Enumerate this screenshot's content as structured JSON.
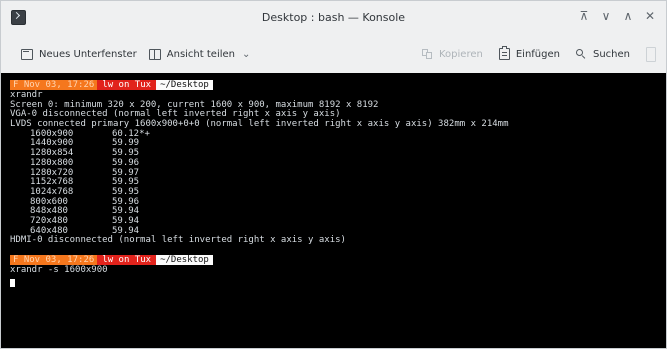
{
  "window": {
    "title": "Desktop : bash — Konsole",
    "controls": [
      {
        "name": "keep-above-button",
        "glyph": "⊼"
      },
      {
        "name": "minimize-button",
        "glyph": "∨"
      },
      {
        "name": "maximize-button",
        "glyph": "∧"
      },
      {
        "name": "close-button",
        "glyph": "✕"
      }
    ]
  },
  "toolbar": {
    "new_tab_label": "Neues Unterfenster",
    "split_view_label": "Ansicht teilen",
    "copy_label": "Kopieren",
    "paste_label": "Einfügen",
    "find_label": "Suchen"
  },
  "terminal": {
    "prompt1": {
      "time": "F Nov 03, 17:26",
      "user": "lw on Tux",
      "dir": "~/Desktop"
    },
    "command1": "xrandr",
    "lines": [
      "Screen 0: minimum 320 x 200, current 1600 x 900, maximum 8192 x 8192",
      "VGA-0 disconnected (normal left inverted right x axis y axis)",
      "LVDS connected primary 1600x900+0+0 (normal left inverted right x axis y axis) 382mm x 214mm"
    ],
    "modes": [
      {
        "name": "1600x900",
        "rate": "60.12*+"
      },
      {
        "name": "1440x900",
        "rate": "59.99"
      },
      {
        "name": "1280x854",
        "rate": "59.95"
      },
      {
        "name": "1280x800",
        "rate": "59.96"
      },
      {
        "name": "1280x720",
        "rate": "59.97"
      },
      {
        "name": "1152x768",
        "rate": "59.95"
      },
      {
        "name": "1024x768",
        "rate": "59.95"
      },
      {
        "name": "800x600",
        "rate": "59.96"
      },
      {
        "name": "848x480",
        "rate": "59.94"
      },
      {
        "name": "720x480",
        "rate": "59.94"
      },
      {
        "name": "640x480",
        "rate": "59.94"
      }
    ],
    "hdmi_line": "HDMI-0 disconnected (normal left inverted right x axis y axis)",
    "prompt2": {
      "time": "F Nov 03, 17:26",
      "user": "lw on Tux",
      "dir": "~/Desktop"
    },
    "command2": "xrandr -s 1600x900"
  }
}
